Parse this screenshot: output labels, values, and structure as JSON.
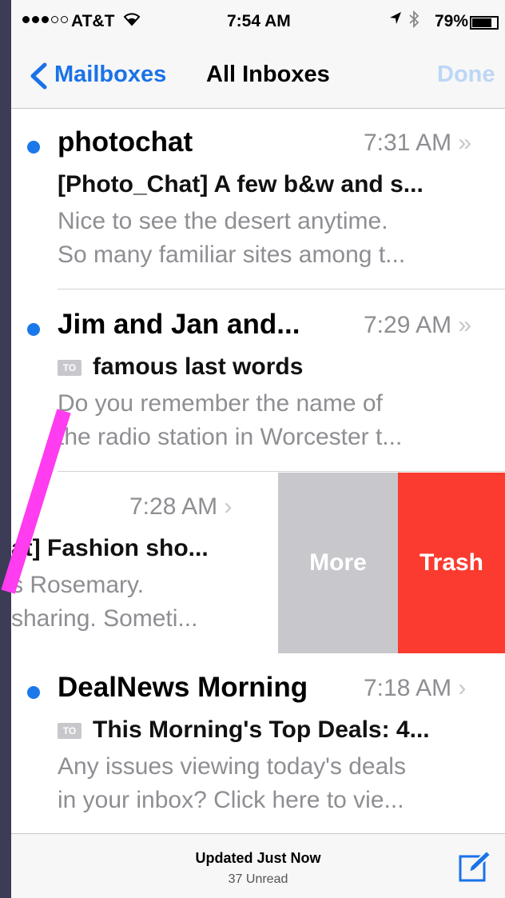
{
  "status_bar": {
    "carrier": "AT&T",
    "time": "7:54 AM",
    "battery_pct": "79%",
    "battery_level": 0.79,
    "signal_bars": 3,
    "icons": [
      "signal-icon",
      "wifi-icon",
      "location-arrow-icon",
      "bluetooth-icon",
      "battery-icon"
    ]
  },
  "nav": {
    "back_label": "Mailboxes",
    "title": "All Inboxes",
    "done_label": "Done"
  },
  "messages": [
    {
      "sender": "photochat",
      "time": "7:31 AM",
      "subject": "[Photo_Chat] A few b&w and s...",
      "preview1": "Nice to see the desert anytime.",
      "preview2": "So many familiar sites among t...",
      "unread": true
    },
    {
      "sender": "Jim and Jan and...",
      "time": "7:29 AM",
      "to_badge": "TO",
      "subject": "famous last words",
      "preview1": "Do you remember the name of",
      "preview2": "the radio station in Worcester t...",
      "unread": true
    },
    {
      "time": "7:28 AM",
      "subject": "at] Fashion sho...",
      "preview1": "s Rosemary.",
      "preview2": "sharing. Someti...",
      "unread": false
    },
    {
      "sender": "DealNews Morning",
      "time": "7:18 AM",
      "to_badge": "TO",
      "subject": "This Morning's Top Deals: 4...",
      "preview1": "Any issues viewing today's deals",
      "preview2": "in your inbox? Click here to vie...",
      "unread": true
    }
  ],
  "swipe_actions": {
    "more_label": "More",
    "trash_label": "Trash"
  },
  "toolbar": {
    "updated": "Updated Just Now",
    "unread_count": "37 Unread"
  },
  "colors": {
    "accent": "#1a72e8",
    "unread_dot": "#1a78ea",
    "trash": "#fb3b30",
    "more": "#c7c7cc",
    "annotation": "#ff3cf0"
  }
}
